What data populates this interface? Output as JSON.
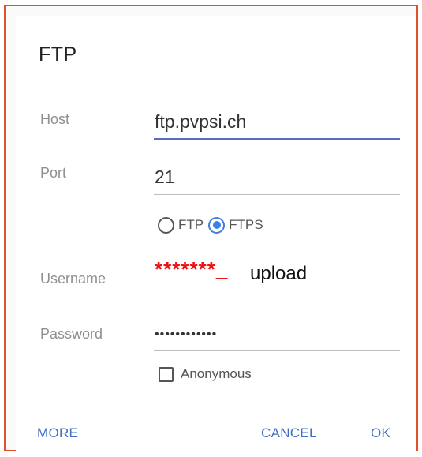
{
  "dialog": {
    "title": "FTP"
  },
  "host": {
    "label": "Host",
    "value": "ftp.pvpsi.ch"
  },
  "port": {
    "label": "Port",
    "value": "21"
  },
  "protocol": {
    "options": [
      "FTP",
      "FTPS"
    ],
    "selected": "FTPS"
  },
  "username": {
    "label": "Username",
    "redacted_part": "*******_",
    "visible_part": "upload"
  },
  "password": {
    "label": "Password",
    "masked_value": "••••••••••••"
  },
  "anonymous": {
    "label": "Anonymous",
    "checked": false
  },
  "actions": {
    "more": "MORE",
    "cancel": "CANCEL",
    "ok": "OK"
  },
  "colors": {
    "frame_border": "#e0502a",
    "accent": "#3f7fe0",
    "action_text": "#3f6ec4",
    "redaction": "#ee1111",
    "focused_underline": "#5c6bc0"
  }
}
